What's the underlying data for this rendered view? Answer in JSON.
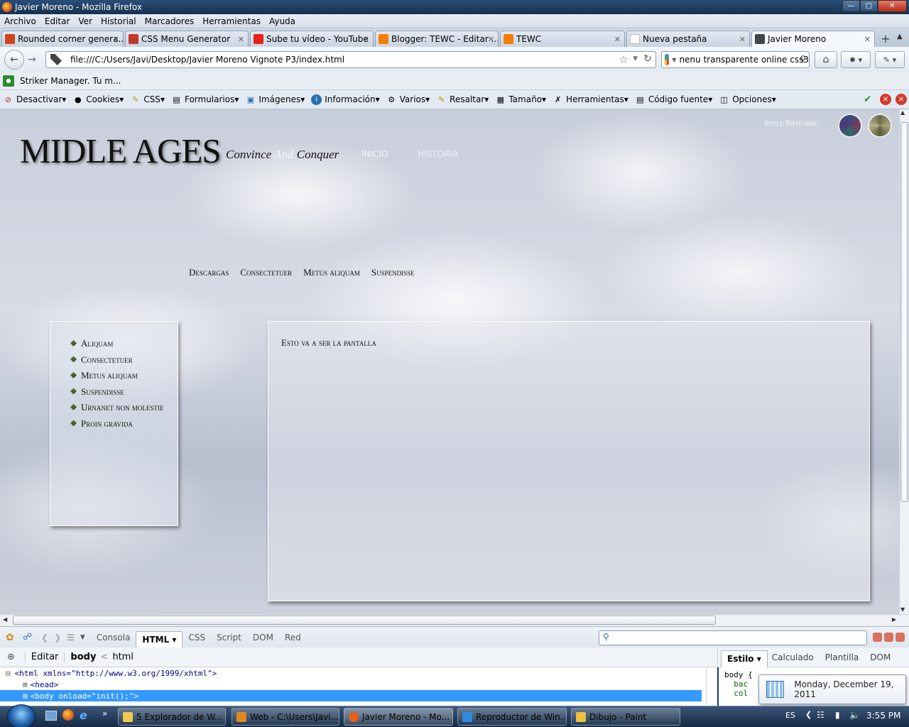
{
  "window": {
    "title": "Javier Moreno - Mozilla Firefox"
  },
  "menu": [
    "Archivo",
    "Editar",
    "Ver",
    "Historial",
    "Marcadores",
    "Herramientas",
    "Ayuda"
  ],
  "tabs": [
    {
      "label": "Rounded corner genera...",
      "icon_color": "#d0451b"
    },
    {
      "label": "CSS Menu Generator",
      "icon_color": "#c0392b"
    },
    {
      "label": "Sube tu vídeo - YouTube",
      "icon_color": "#e62117"
    },
    {
      "label": "Blogger: TEWC - Editar ...",
      "icon_color": "#f57d00"
    },
    {
      "label": "TEWC",
      "icon_color": "#f57d00"
    },
    {
      "label": "Nueva pestaña",
      "icon_color": "#ffffff"
    },
    {
      "label": "Javier Moreno",
      "icon_color": "#444444",
      "active": true
    }
  ],
  "new_tab_label": "+",
  "address": {
    "url": "file:///C:/Users/Javi/Desktop/Javier Moreno Vignote P3/index.html"
  },
  "search": {
    "value": "nenu transparente online css3"
  },
  "bookmarks": [
    {
      "label": "Striker Manager. Tu m..."
    }
  ],
  "webdev": [
    "Desactivar",
    "Cookies",
    "CSS",
    "Formularios",
    "Imágenes",
    "Información",
    "Varios",
    "Resaltar",
    "Tamaño",
    "Herramientas",
    "Código fuente",
    "Opciones"
  ],
  "site": {
    "logo": "MIDLE AGES",
    "tagline_a": "Convince",
    "tagline_b": "And",
    "tagline_c": "Conquer",
    "top_nav": [
      "INICIO",
      "HISTORIA"
    ],
    "style_switcher_label": "Style Switcher:",
    "main_nav": [
      "Descargas",
      "Consectetuer",
      "Metus aliquam",
      "Suspendisse"
    ],
    "sidebar": [
      "Aliquam",
      "Consectetuer",
      "Metus aliquam",
      "Suspendisse",
      "Urnanet non molestie",
      "Proin gravida"
    ],
    "content_text": "Esto va a ser la pantalla"
  },
  "firebug": {
    "tabs": [
      "Consola",
      "HTML",
      "CSS",
      "Script",
      "DOM",
      "Red"
    ],
    "active_tab": "HTML",
    "edit_label": "Editar",
    "breadcrumb": [
      "body",
      "<",
      "html"
    ],
    "side_tabs": [
      "Estilo",
      "Calculado",
      "Plantilla",
      "DOM"
    ],
    "tree": [
      "<html xmlns=\"http://www.w3.org/1999/xhtml\">",
      "<head>",
      "<body onload=\"init();\">"
    ],
    "css_lines": [
      "body {",
      "  bac",
      "  col"
    ]
  },
  "tooltip": {
    "date": "Monday, December 19, 2011"
  },
  "taskbar": {
    "items": [
      {
        "label": "5 Explorador de W...",
        "icon_color": "#f2c94c"
      },
      {
        "label": "Web - C:\\Users\\Javi...",
        "icon_color": "#e08a1e"
      },
      {
        "label": "Javier Moreno - Mo...",
        "icon_color": "#e2601a"
      },
      {
        "label": "Reproductor de Win...",
        "icon_color": "#2d8be0"
      },
      {
        "label": "Dibujo - Paint",
        "icon_color": "#f0c040"
      }
    ],
    "language": "ES",
    "clock": "3:55 PM"
  }
}
